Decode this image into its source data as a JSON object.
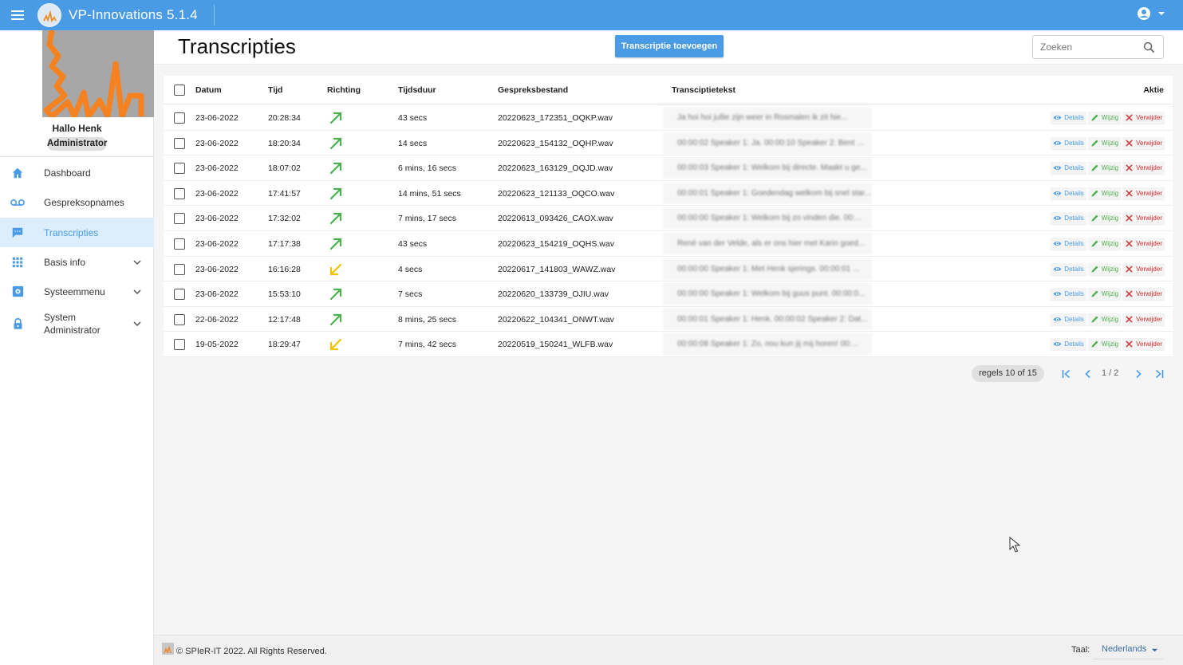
{
  "app": {
    "title": "VP-Innovations 5.1.4"
  },
  "sidebar": {
    "greeting": "Hallo Henk",
    "role": "Administrator",
    "items": [
      {
        "label": "Dashboard",
        "icon": "home-icon"
      },
      {
        "label": "Gespreksopnames",
        "icon": "voicemail-icon"
      },
      {
        "label": "Transcripties",
        "icon": "chat-icon",
        "active": true
      },
      {
        "label": "Basis info",
        "icon": "grid-icon",
        "expandable": true
      },
      {
        "label": "Systeemmenu",
        "icon": "settings-icon",
        "expandable": true
      },
      {
        "label": "System Administrator",
        "icon": "lock-icon",
        "expandable": true
      }
    ]
  },
  "main": {
    "title": "Transcripties",
    "add_button": "Transcriptie toevoegen",
    "search_placeholder": "Zoeken"
  },
  "table": {
    "headers": {
      "date": "Datum",
      "time": "Tijd",
      "direction": "Richting",
      "duration": "Tijdsduur",
      "file": "Gespreksbestand",
      "text": "Transciptietekst",
      "action": "Aktie"
    },
    "action_labels": {
      "details": "Details",
      "edit": "Wijzig",
      "delete": "Verwijder"
    },
    "rows": [
      {
        "date": "23-06-2022",
        "time": "20:28:34",
        "direction": "outgoing",
        "duration": "43 secs",
        "file": "20220623_172351_OQKP.wav",
        "text": "Ja hoi hoi jullie zijn weer in Rosmalen ik zit hie..."
      },
      {
        "date": "23-06-2022",
        "time": "18:20:34",
        "direction": "outgoing",
        "duration": "14 secs",
        "file": "20220623_154132_OQHP.wav",
        "text": "00:00:02 Speaker 1: Ja. 00:00:10 Speaker 2: Bent ..."
      },
      {
        "date": "23-06-2022",
        "time": "18:07:02",
        "direction": "outgoing",
        "duration": "6 mins, 16 secs",
        "file": "20220623_163129_OQJD.wav",
        "text": "00:00:03 Speaker 1: Welkom bij directe. Maakt u ge..."
      },
      {
        "date": "23-06-2022",
        "time": "17:41:57",
        "direction": "outgoing",
        "duration": "14 mins, 51 secs",
        "file": "20220623_121133_OQCO.wav",
        "text": "00:00:01 Speaker 1: Goedendag welkom bij snel star..."
      },
      {
        "date": "23-06-2022",
        "time": "17:32:02",
        "direction": "outgoing",
        "duration": "7 mins, 17 secs",
        "file": "20220613_093426_CAOX.wav",
        "text": "00:00:00 Speaker 1: Welkom bij zo vinden die. 00:..."
      },
      {
        "date": "23-06-2022",
        "time": "17:17:38",
        "direction": "outgoing",
        "duration": "43 secs",
        "file": "20220623_154219_OQHS.wav",
        "text": "René van der Velde, als er ons hier met Karin goed..."
      },
      {
        "date": "23-06-2022",
        "time": "16:16:28",
        "direction": "incoming",
        "duration": "4 secs",
        "file": "20220617_141803_WAWZ.wav",
        "text": "00:00:00 Speaker 1: Met Henk sjerings. 00:00:01 ..."
      },
      {
        "date": "23-06-2022",
        "time": "15:53:10",
        "direction": "outgoing",
        "duration": "7 secs",
        "file": "20220620_133739_OJIU.wav",
        "text": "00:00:00 Speaker 1: Welkom bij guus punt. 00:00:0..."
      },
      {
        "date": "22-06-2022",
        "time": "12:17:48",
        "direction": "outgoing",
        "duration": "8 mins, 25 secs",
        "file": "20220622_104341_ONWT.wav",
        "text": "00:00:01 Speaker 1: Henk. 00:00:02 Speaker 2: Dat..."
      },
      {
        "date": "19-05-2022",
        "time": "18:29:47",
        "direction": "incoming",
        "duration": "7 mins, 42 secs",
        "file": "20220519_150241_WLFB.wav",
        "text": "00:00:08 Speaker 1: Zo, nou kun jij mij horen! 00:..."
      }
    ]
  },
  "pagination": {
    "rows_label": "regels 10 of 15",
    "page": "1 / 2"
  },
  "footer": {
    "copyright": "© SPIeR-IT 2022. All Rights Reserved.",
    "language_label": "Taal:",
    "language": "Nederlands"
  },
  "colors": {
    "primary": "#4a9be6",
    "outgoing": "#4caf50",
    "incoming": "#f2c200",
    "delete": "#d32f2f"
  }
}
